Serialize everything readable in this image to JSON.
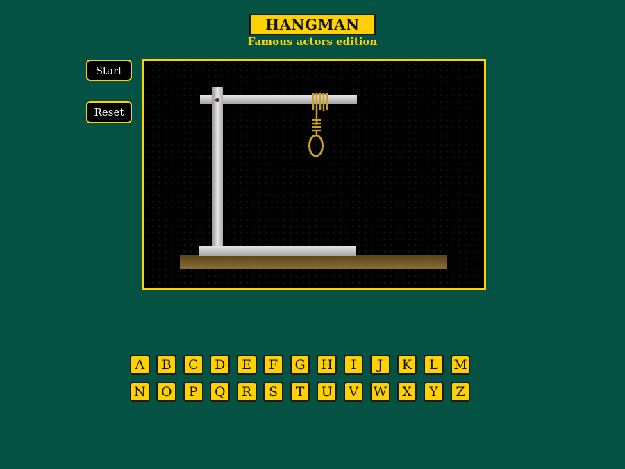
{
  "header": {
    "title": "HANGMAN",
    "subtitle": "Famous actors edition"
  },
  "controls": {
    "start_label": "Start",
    "reset_label": "Reset"
  },
  "letters": {
    "row1": [
      "A",
      "B",
      "C",
      "D",
      "E",
      "F",
      "G",
      "H",
      "I",
      "J",
      "K",
      "L",
      "M"
    ],
    "row2": [
      "N",
      "O",
      "P",
      "Q",
      "R",
      "S",
      "T",
      "U",
      "V",
      "W",
      "X",
      "Y",
      "Z"
    ]
  },
  "colors": {
    "background": "#035243",
    "accent": "#ffd100",
    "stage_bg": "#000000",
    "gallows": "#c8c8c8",
    "ground": "#6b5320",
    "rope": "#c9a020"
  },
  "icons": {
    "gallows": "gallows-icon",
    "noose": "noose-icon"
  }
}
